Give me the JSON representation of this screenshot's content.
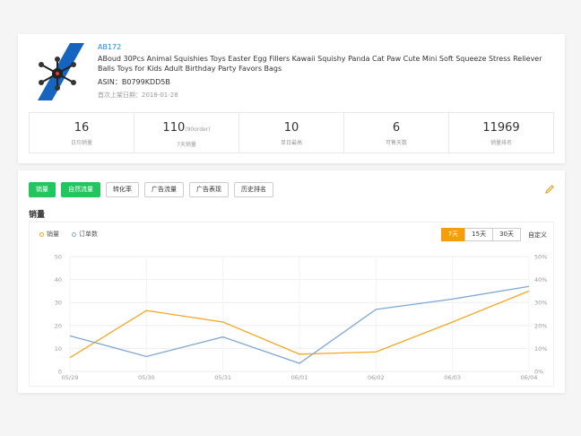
{
  "product": {
    "sku": "AB172",
    "title": "ABoud 30Pcs Animal Squishies Toys Easter Egg Fillers Kawaii Squishy Panda Cat Paw Cute Mini Soft Squeeze Stress Reliever Balls Toys for Kids Adult Birthday Party Favors Bags",
    "asin": "ASIN：B0799KDD5B",
    "first_listed": "首次上架日期：2018-01-28"
  },
  "stats": [
    {
      "value": "16",
      "unit": "",
      "label": "日均销量"
    },
    {
      "value": "110",
      "unit": "(90order)",
      "label": "7天销量"
    },
    {
      "value": "10",
      "unit": "",
      "label": "单日最高"
    },
    {
      "value": "6",
      "unit": "",
      "label": "可售天数"
    },
    {
      "value": "11969",
      "unit": "",
      "label": "销量排名"
    }
  ],
  "tabs": [
    {
      "label": "销量",
      "active": true
    },
    {
      "label": "自然流量",
      "active": true
    },
    {
      "label": "转化率",
      "active": false
    },
    {
      "label": "广告流量",
      "active": false
    },
    {
      "label": "广告表现",
      "active": false
    },
    {
      "label": "历史排名",
      "active": false
    }
  ],
  "section_title": "销量",
  "ranges": [
    {
      "label": "7天",
      "active": true
    },
    {
      "label": "15天",
      "active": false
    },
    {
      "label": "30天",
      "active": false
    }
  ],
  "custom_label": "自定义",
  "icons": {
    "edit": "pencil-icon",
    "product": "drone-image"
  },
  "colors": {
    "accent_green": "#22c55e",
    "accent_orange": "#f59e0b",
    "series_sales": "#f5a623",
    "series_orders": "#7fa7d4"
  },
  "chart_data": {
    "type": "line",
    "x": [
      "05/29",
      "05/30",
      "05/31",
      "06/01",
      "06/02",
      "06/03",
      "06/04"
    ],
    "series": [
      {
        "name": "销量",
        "axis": "left",
        "color": "#f5a623",
        "values": [
          6,
          26.5,
          21.5,
          7.5,
          8.5,
          21.5,
          35
        ]
      },
      {
        "name": "订单数",
        "axis": "right",
        "color": "#7fa7d4",
        "values": [
          15.5,
          6.5,
          15,
          3.5,
          27,
          31.5,
          37
        ]
      }
    ],
    "y_left": {
      "ticks": [
        "0",
        "10",
        "20",
        "30",
        "40",
        "50"
      ],
      "range": [
        0,
        50
      ]
    },
    "y_right": {
      "ticks": [
        "0%",
        "10%",
        "20%",
        "30%",
        "40%",
        "50%"
      ],
      "range": [
        0,
        50
      ]
    },
    "grid": true,
    "legend": "top-left"
  }
}
